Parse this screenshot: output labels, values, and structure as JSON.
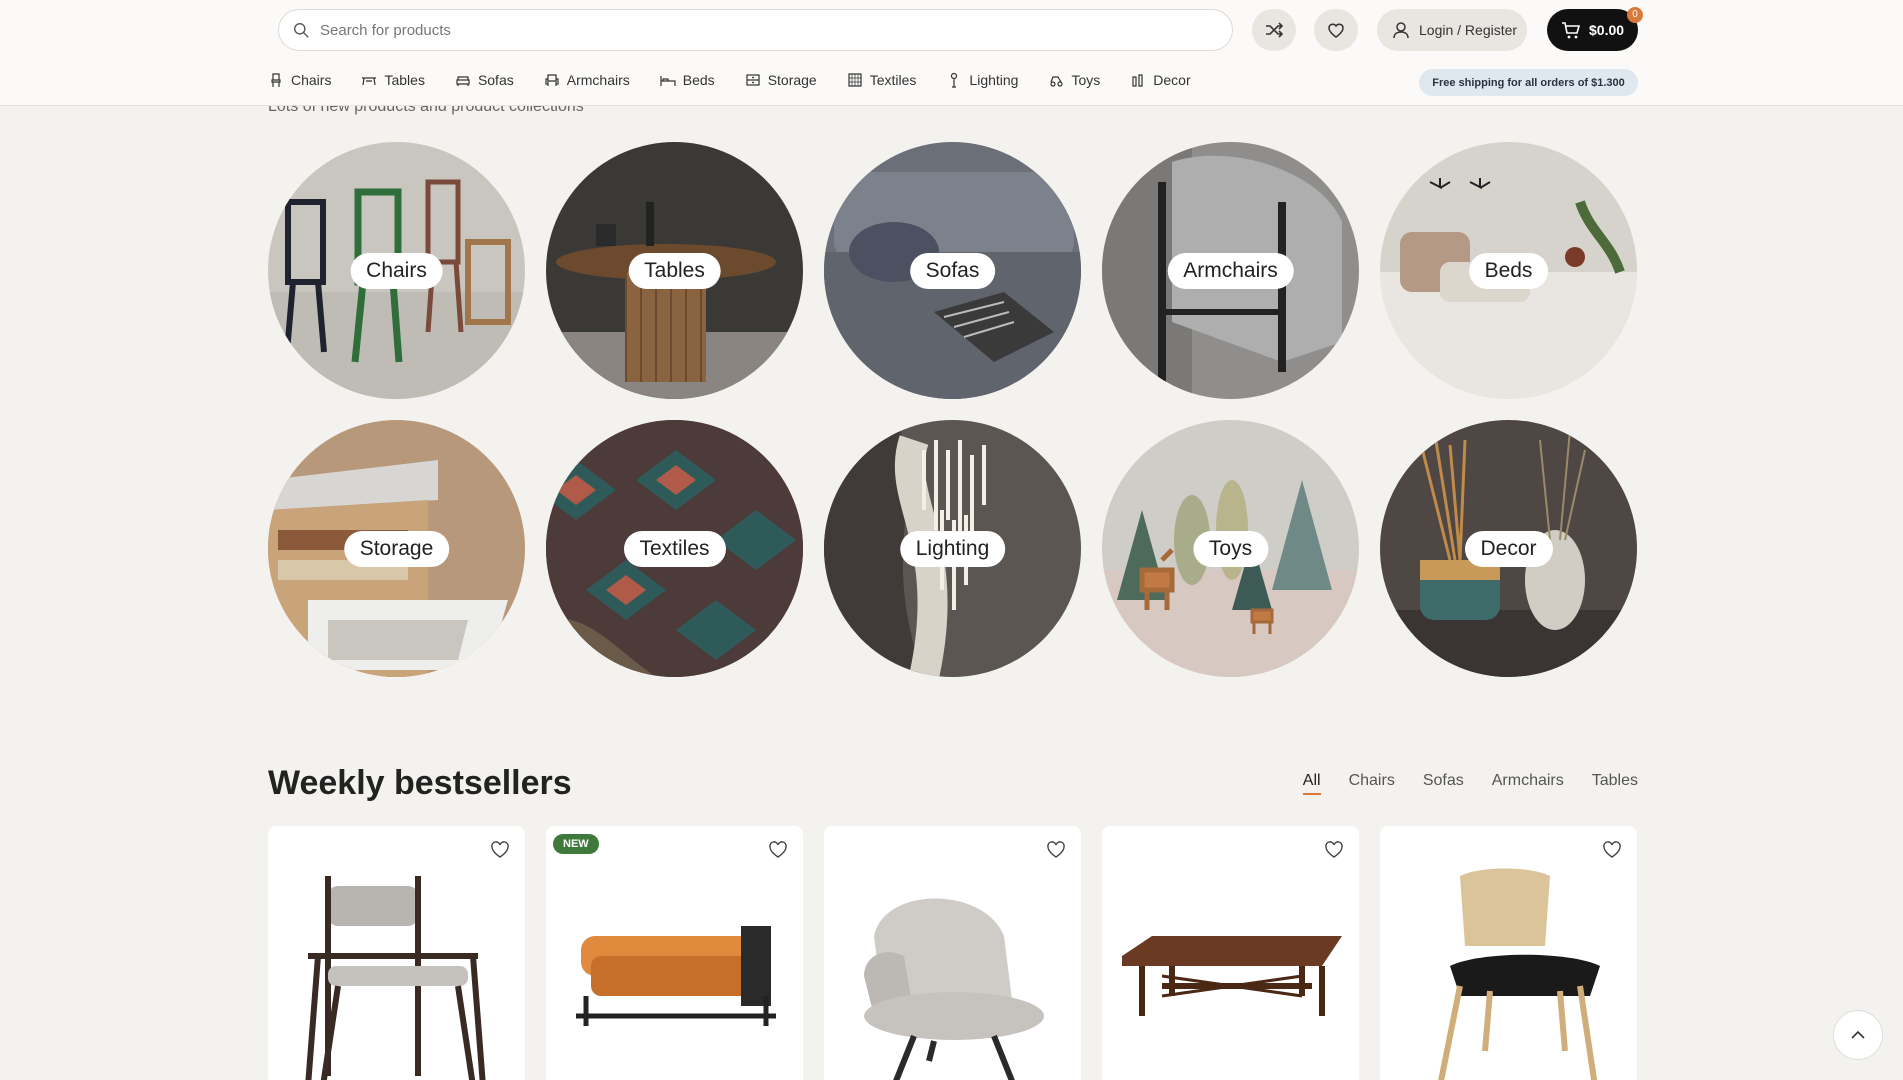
{
  "search": {
    "placeholder": "Search for products"
  },
  "header": {
    "login_label": "Login / Register",
    "cart_total": "$0.00",
    "cart_count": "0",
    "shipping_note": "Free shipping for all orders of $1.300"
  },
  "nav": {
    "items": [
      {
        "label": "Chairs",
        "icon": "chair-icon"
      },
      {
        "label": "Tables",
        "icon": "table-icon"
      },
      {
        "label": "Sofas",
        "icon": "sofa-icon"
      },
      {
        "label": "Armchairs",
        "icon": "armchair-icon"
      },
      {
        "label": "Beds",
        "icon": "bed-icon"
      },
      {
        "label": "Storage",
        "icon": "storage-icon"
      },
      {
        "label": "Textiles",
        "icon": "textile-icon"
      },
      {
        "label": "Lighting",
        "icon": "lamp-icon"
      },
      {
        "label": "Toys",
        "icon": "toy-icon"
      },
      {
        "label": "Decor",
        "icon": "decor-icon"
      }
    ]
  },
  "categories": {
    "subtitle": "Lots of new products and product collections",
    "items": [
      {
        "label": "Chairs"
      },
      {
        "label": "Tables"
      },
      {
        "label": "Sofas"
      },
      {
        "label": "Armchairs"
      },
      {
        "label": "Beds"
      },
      {
        "label": "Storage"
      },
      {
        "label": "Textiles"
      },
      {
        "label": "Lighting"
      },
      {
        "label": "Toys"
      },
      {
        "label": "Decor"
      }
    ]
  },
  "bestsellers": {
    "title": "Weekly bestsellers",
    "filters": [
      "All",
      "Chairs",
      "Sofas",
      "Armchairs",
      "Tables"
    ],
    "active_filter": "All",
    "new_badge": "NEW"
  },
  "colors": {
    "accent": "#d87a3a",
    "badge_green": "#3f7a3c",
    "cart_bg": "#111111"
  }
}
